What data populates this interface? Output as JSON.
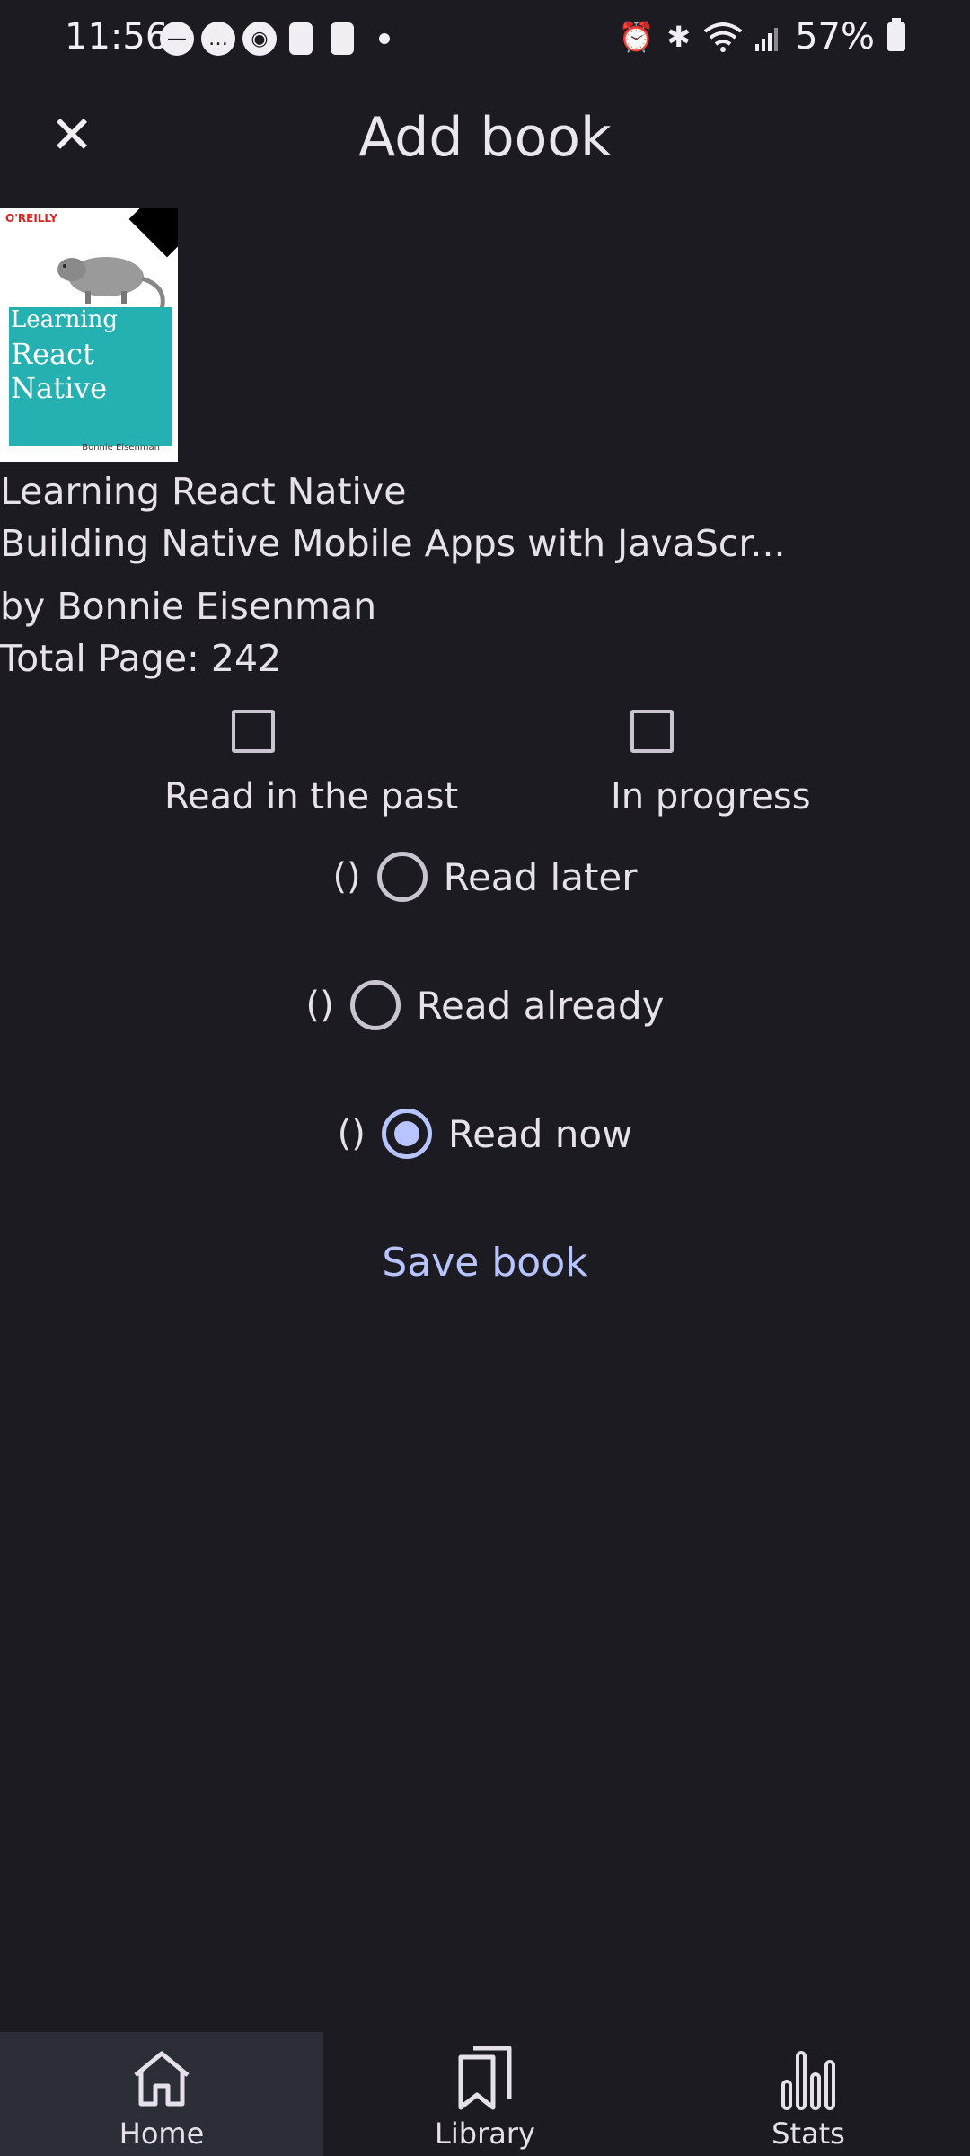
{
  "status_bar": {
    "time": "11:56",
    "battery": "57%"
  },
  "app_bar": {
    "title": "Add book"
  },
  "book": {
    "title": "Learning React Native",
    "subtitle": "Building Native Mobile Apps with JavaScr...",
    "author": "by Bonnie Eisenman",
    "total_pages": "Total Page: 242",
    "cover": {
      "publisher": "O'REILLY",
      "title_lines": [
        "Learning",
        "React",
        "Native"
      ],
      "author": "Bonnie Eisenman",
      "accent": "#25b1b1"
    }
  },
  "checkboxes": [
    {
      "label": "Read in the past",
      "checked": false
    },
    {
      "label": "In progress",
      "checked": false
    }
  ],
  "radios": [
    {
      "prefix": "()",
      "label": "Read later",
      "checked": false
    },
    {
      "prefix": "()",
      "label": "Read already",
      "checked": false
    },
    {
      "prefix": "()",
      "label": "Read now",
      "checked": true
    }
  ],
  "save_label": "Save book",
  "nav": [
    {
      "label": "Home",
      "icon": "home-icon",
      "active": true
    },
    {
      "label": "Library",
      "icon": "bookmarks-icon",
      "active": false
    },
    {
      "label": "Stats",
      "icon": "bar-chart-icon",
      "active": false
    }
  ],
  "colors": {
    "background": "#1c1b21",
    "accent": "#b7c4ff",
    "nav_active": "#2c2e37"
  }
}
